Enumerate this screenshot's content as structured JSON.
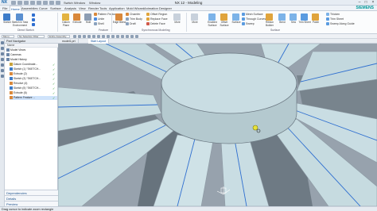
{
  "app": {
    "title": "NX 12 - Modeling",
    "logo": "NX",
    "window_menu": {
      "switch": "Switch Window",
      "window": "Window"
    },
    "brand": "SIEMENS"
  },
  "tabs": [
    "File",
    "Home",
    "Assemblies",
    "Curve",
    "Surface",
    "Analysis",
    "View",
    "Render",
    "Tools",
    "Application",
    "Mold Wizard",
    "Animation Designer"
  ],
  "active_tab": "Home",
  "ribbon": {
    "sketch": "Sketch",
    "sketch_in_task": "Sketch in Task Environment",
    "direct_sketch": "Direct Sketch",
    "datum_plane": "Datum Plane",
    "extrude": "Extrude",
    "hole": "Hole",
    "pattern_feature": "Pattern Feature",
    "unite": "Unite",
    "shell": "Shell",
    "feature_group": "Feature",
    "edge_blend": "Edge Blend",
    "chamfer": "Chamfer",
    "trim_body": "Trim Body",
    "draft": "Draft",
    "offset_region": "Offset Region",
    "replace_face": "Replace Face",
    "delete_face": "Delete Face",
    "more": "More",
    "synchronous_group": "Synchronous Modeling",
    "enabled_surface": "Enabled Surface",
    "offset_surface": "Offset Surface",
    "surface": "Surface",
    "mesh_surface": "Mesh Surface",
    "through_curves": "Through Curves",
    "sweep": "Sweep",
    "ribbon_builder": "Ribbon Builder",
    "bend": "Bend",
    "sew": "Sew",
    "trim_sheet": "Trim Sheet",
    "patch": "Patch",
    "thicken": "Thicken",
    "sweep_along_guide": "Sweep Along Guide",
    "surface_group": "Surface"
  },
  "command_row": {
    "menu": "Menu",
    "filter": "No Selection Filter",
    "scope": "Entire Assembly"
  },
  "navigator": {
    "title": "Part Navigator",
    "col_name": "Name",
    "tree": [
      {
        "label": "Model Views",
        "level": 0
      },
      {
        "label": "Cameras",
        "level": 0
      },
      {
        "label": "Model History",
        "level": 0
      },
      {
        "label": "Datum Coordinate...",
        "level": 1
      },
      {
        "label": "Sketch (1) \"SKETCH...",
        "level": 1
      },
      {
        "label": "Extrude (2)",
        "level": 1
      },
      {
        "label": "Sketch (3) \"SKETCH...",
        "level": 1
      },
      {
        "label": "Revolve (4)",
        "level": 1
      },
      {
        "label": "Sketch (5) \"SKETCH...",
        "level": 1
      },
      {
        "label": "Extrude (6)",
        "level": 1
      },
      {
        "label": "Pattern Feature ...",
        "level": 1
      }
    ],
    "panels": [
      "Dependencies",
      "Details",
      "Preview"
    ]
  },
  "graphics_tabs": [
    "model1.prt",
    "Start Layout"
  ],
  "status": "Drag cursor to indicate zoom rectangle",
  "colors": {
    "model_face": "#c9dde3",
    "model_shadow": "#6f7b85",
    "spoke_line": "#2f6fd0",
    "background": "#96a0aa"
  }
}
